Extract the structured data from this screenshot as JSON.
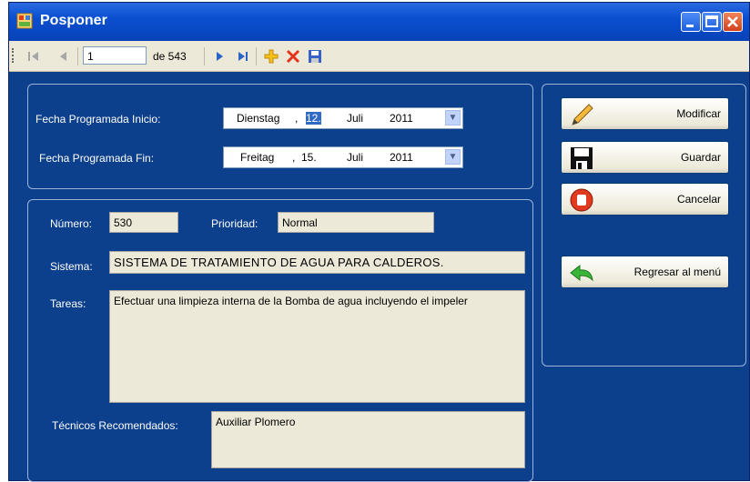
{
  "window": {
    "title": "Posponer"
  },
  "navigator": {
    "position": "1",
    "of_label": "de 543"
  },
  "schedule": {
    "start_label": "Fecha Programada Inicio:",
    "start": {
      "weekday": "Dienstag",
      "day": "12.",
      "month": "Juli",
      "year": "2011"
    },
    "end_label": "Fecha Programada Fin:",
    "end": {
      "weekday": "Freitag",
      "day": "15.",
      "month": "Juli",
      "year": "2011"
    }
  },
  "details": {
    "numero_label": "Número:",
    "numero_value": "530",
    "prioridad_label": "Prioridad:",
    "prioridad_value": "Normal",
    "sistema_label": "Sistema:",
    "sistema_value": "SISTEMA DE TRATAMIENTO DE AGUA PARA CALDEROS.",
    "tareas_label": "Tareas:",
    "tareas_value": "Efectuar una limpieza interna de la Bomba de agua incluyendo el impeler",
    "tecnicos_label": "Técnicos Recomendados:",
    "tecnicos_value": "Auxiliar Plomero"
  },
  "actions": {
    "modificar": "Modificar",
    "guardar": "Guardar",
    "cancelar": "Cancelar",
    "regresar": "Regresar al menú"
  }
}
